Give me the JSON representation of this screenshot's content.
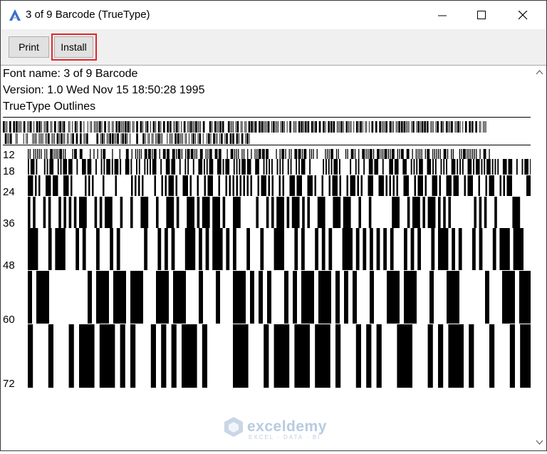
{
  "window": {
    "title": "3 of 9 Barcode (TrueType)"
  },
  "toolbar": {
    "print_label": "Print",
    "install_label": "Install"
  },
  "font_info": {
    "name_line": "Font name: 3 of 9 Barcode",
    "version_line": "Version: 1.0 Wed Nov 15 18:50:28 1995",
    "outline_line": "TrueType Outlines"
  },
  "sample_sizes": [
    "12",
    "18",
    "24",
    "36",
    "48",
    "60",
    "72"
  ],
  "watermark": {
    "name": "exceldemy",
    "tagline": "EXCEL · DATA · BI"
  },
  "colors": {
    "highlight": "#e0262a",
    "toolbar_bg": "#f0f0f0"
  },
  "icons": {
    "app": "font-viewer-icon",
    "minimize": "minimize-icon",
    "maximize": "maximize-icon",
    "close": "close-icon"
  }
}
